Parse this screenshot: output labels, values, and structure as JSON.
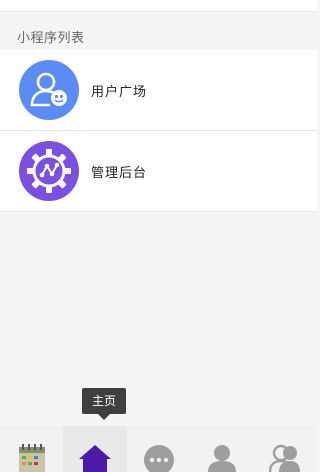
{
  "section": {
    "title": "小程序列表"
  },
  "apps": [
    {
      "label": "用户广场",
      "icon": "user-square-icon",
      "color": "#5b8cf6"
    },
    {
      "label": "管理后台",
      "icon": "admin-gear-icon",
      "color": "#7b4fe0"
    }
  ],
  "tooltip": {
    "text": "主页"
  },
  "tabbar": {
    "items": [
      {
        "icon": "calendar-app-icon",
        "active": false
      },
      {
        "icon": "home-icon",
        "active": true,
        "color": "#4b1aa8"
      },
      {
        "icon": "chat-bubble-icon",
        "active": false
      },
      {
        "icon": "person-icon",
        "active": false
      },
      {
        "icon": "group-icon",
        "active": false
      }
    ]
  }
}
